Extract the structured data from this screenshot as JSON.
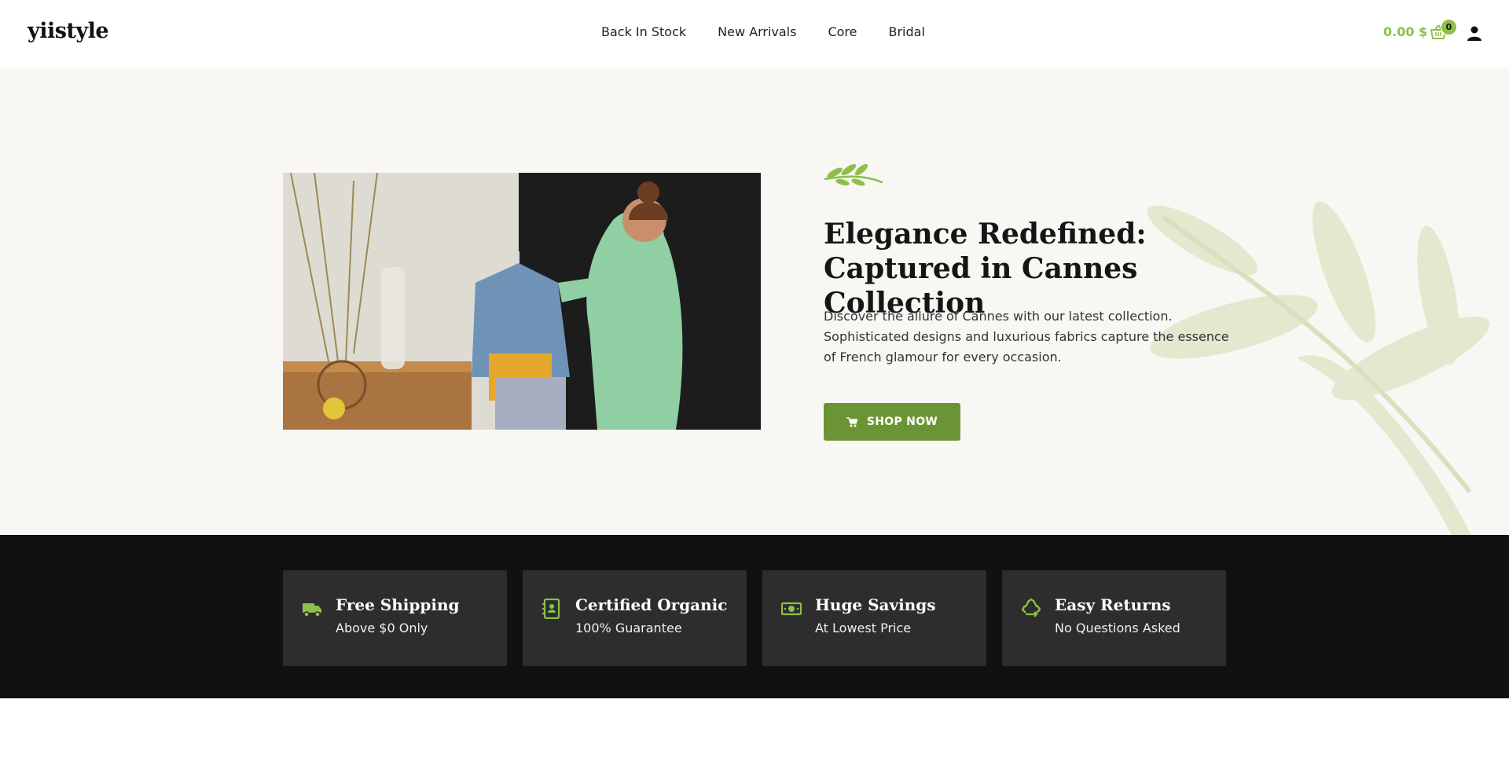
{
  "header": {
    "logo": "yiistyle",
    "nav": [
      "Back In Stock",
      "New Arrivals",
      "Core",
      "Bridal"
    ],
    "cart_total": "0.00 $",
    "cart_count": "0"
  },
  "hero": {
    "title": "Elegance Redefined: Captured in Cannes Collection",
    "description": "Discover the allure of Cannes with our latest collection. Sophisticated designs and luxurious fabrics capture the essence of French glamour for every occasion.",
    "button_label": "SHOP NOW",
    "button_icon": "cart-icon",
    "image_icon": "clothing-rack-photo"
  },
  "features": [
    {
      "icon": "truck-icon",
      "title": "Free Shipping",
      "subtitle": "Above $0 Only"
    },
    {
      "icon": "certificate-icon",
      "title": "Certified Organic",
      "subtitle": "100% Guarantee"
    },
    {
      "icon": "money-icon",
      "title": "Huge Savings",
      "subtitle": "At Lowest Price"
    },
    {
      "icon": "recycle-icon",
      "title": "Easy Returns",
      "subtitle": "No Questions Asked"
    }
  ],
  "colors": {
    "accent": "#8cc04a",
    "button": "#6b9534",
    "band": "#111111",
    "card": "#2d2d2d"
  }
}
